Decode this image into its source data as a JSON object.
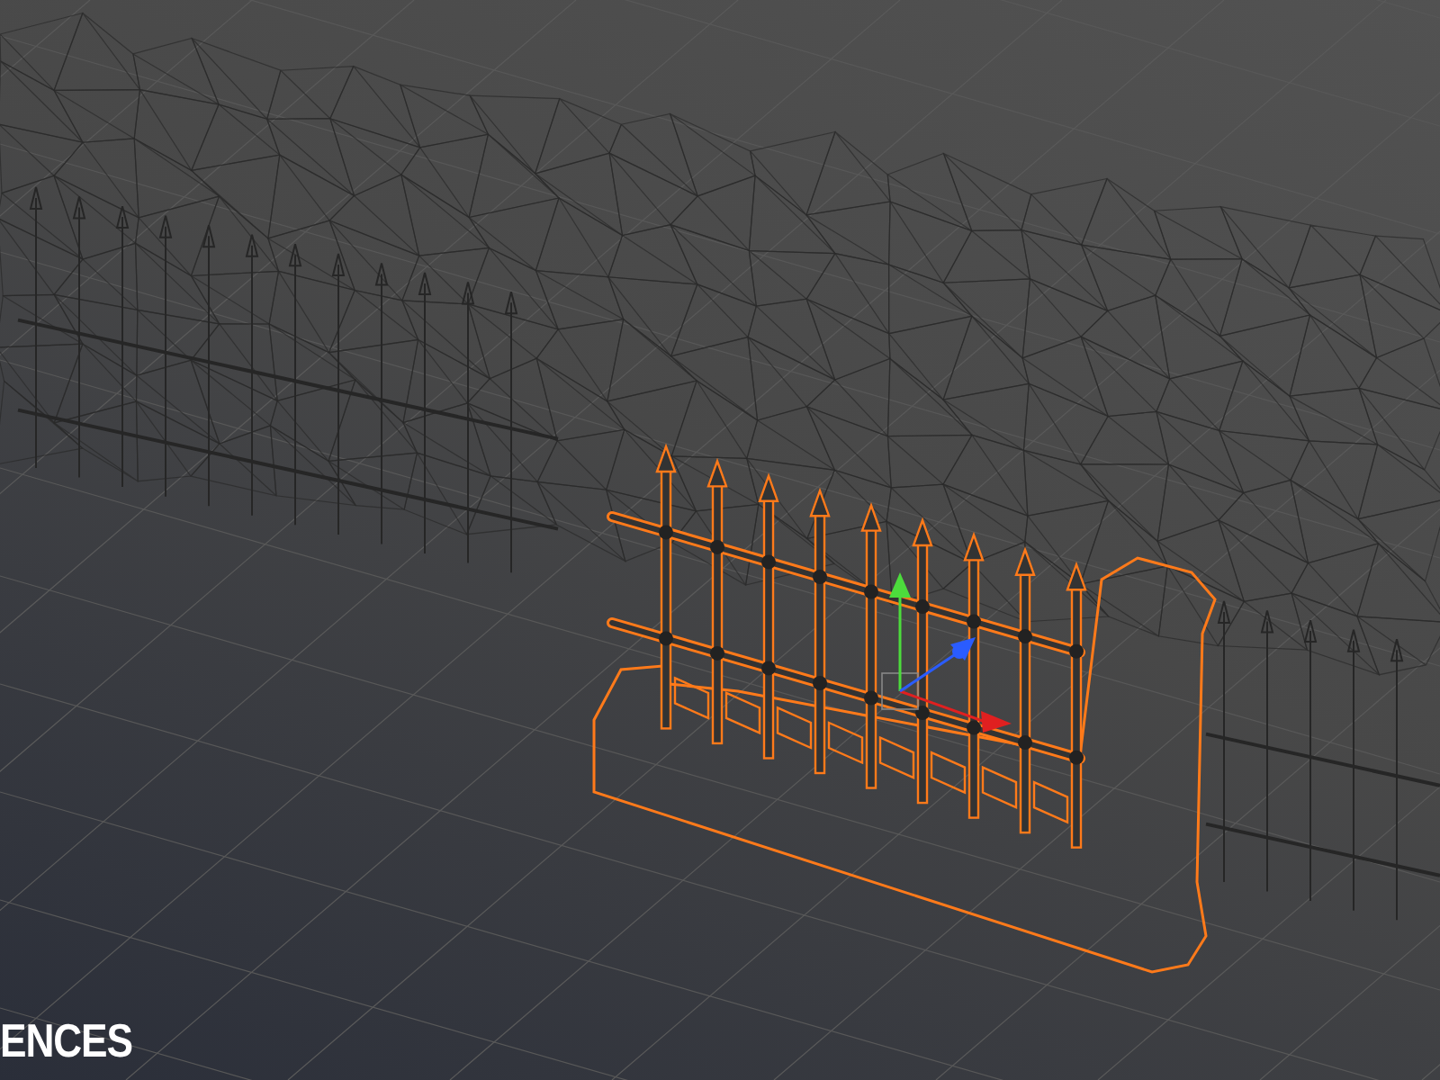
{
  "caption": {
    "text": "ENCES"
  }
}
